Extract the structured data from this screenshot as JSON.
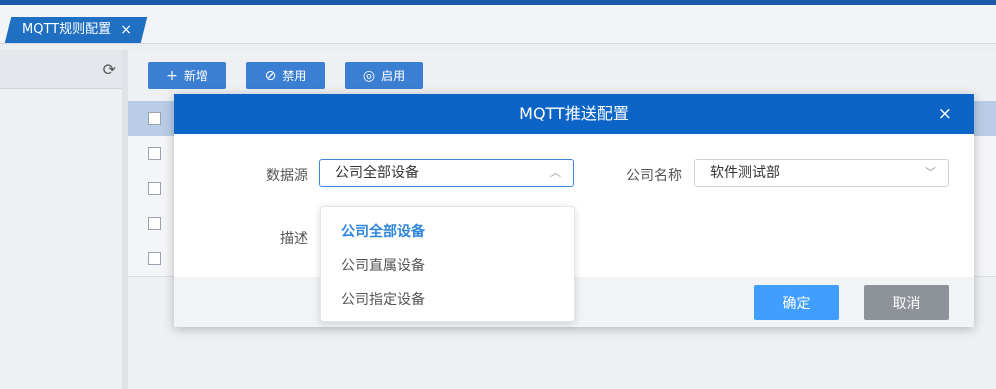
{
  "tab": {
    "label": "MQTT规则配置",
    "close": "×"
  },
  "toolbar": {
    "add_label": "新增",
    "disable_label": "禁用",
    "enable_label": "启用"
  },
  "modal": {
    "title": "MQTT推送配置",
    "close": "×",
    "datasource_label": "数据源",
    "datasource_value": "公司全部设备",
    "company_label": "公司名称",
    "company_value": "软件测试部",
    "desc_label": "描述",
    "confirm_label": "确定",
    "cancel_label": "取消"
  },
  "dropdown": {
    "options": [
      "公司全部设备",
      "公司直属设备",
      "公司指定设备"
    ],
    "selected_index": 0
  },
  "colors": {
    "primary": "#0b64c6",
    "confirm": "#409eff",
    "cancel": "#8e9399",
    "selected_option": "#2f86db"
  }
}
